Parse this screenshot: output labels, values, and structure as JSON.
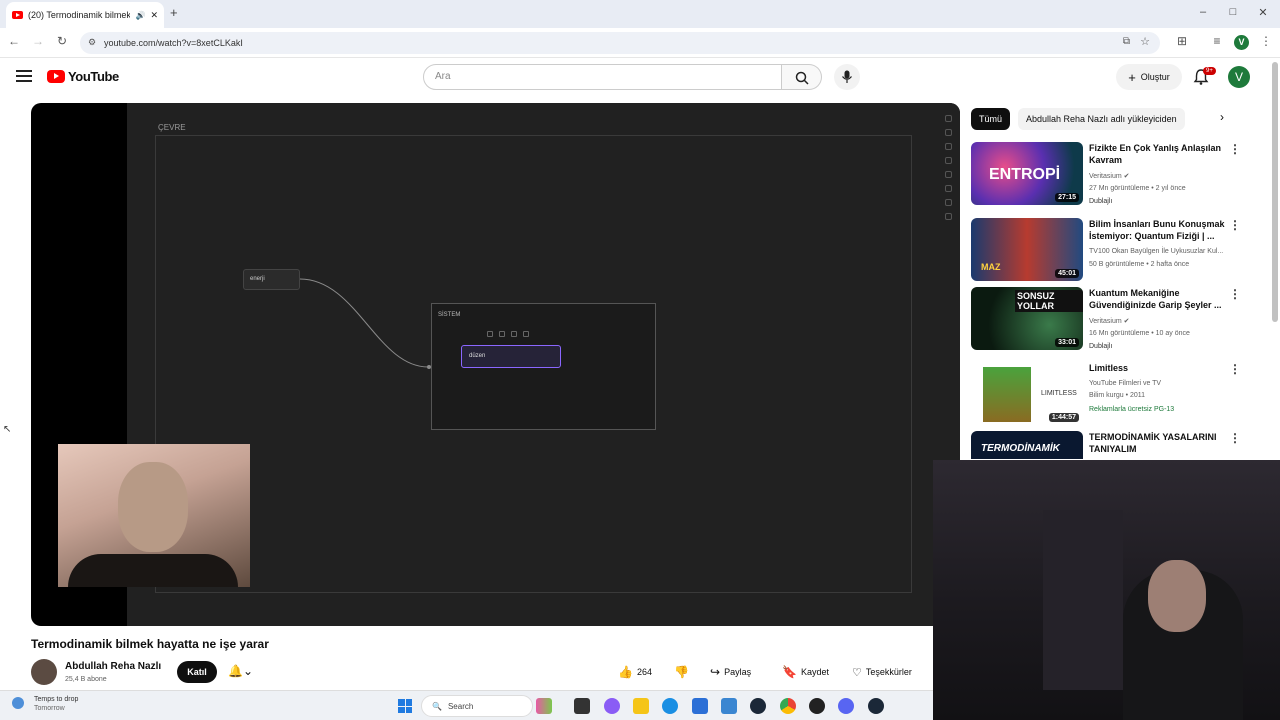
{
  "browser": {
    "tab_title": "(20) Termodinamik bilmek i",
    "new_tab": "+",
    "url": "youtube.com/watch?v=8xetCLKakI"
  },
  "header": {
    "logo": "YouTube",
    "search_placeholder": "Ara",
    "create_label": "Oluştur",
    "notification_badge": "9+",
    "user_initial": "V"
  },
  "player": {
    "frame_label": "ÇEVRE",
    "node_enerji": "enerji",
    "system_label": "SİSTEM",
    "node_duzen": "düzen"
  },
  "video": {
    "title": "Termodinamik bilmek hayatta ne işe yarar",
    "channel": "Abdullah Reha Nazlı",
    "subscribers": "25,4 B abone",
    "join": "Katıl",
    "likes": "264",
    "share": "Paylaş",
    "save": "Kaydet",
    "thanks": "Teşekkürler"
  },
  "chips": [
    "Tümü",
    "Abdullah Reha Nazlı adlı yükleyiciden"
  ],
  "recommendations": [
    {
      "title": "Fizikte En Çok Yanlış Anlaşılan Kavram",
      "channel": "Veritasium",
      "meta": "27 Mn görüntüleme • 2 yıl önce",
      "tag": "Dublajlı",
      "duration": "27:15",
      "thumb_text": "ENTROPİ"
    },
    {
      "title": "Bilim İnsanları Bunu Konuşmak İstemiyor: Quantum Fiziği | ...",
      "channel": "TV100 Okan Bayülgen İle Uykusuzlar Kul...",
      "meta": "50 B görüntüleme • 2 hafta önce",
      "tag": "",
      "duration": "45:01",
      "thumb_text": "MAZ"
    },
    {
      "title": "Kuantum Mekaniğine Güvendiğinizde Garip Şeyler ...",
      "channel": "Veritasium",
      "meta": "16 Mn görüntüleme • 10 ay önce",
      "tag": "Dublajlı",
      "duration": "33:01",
      "thumb_text": "SONSUZ YOLLAR"
    },
    {
      "title": "Limitless",
      "channel": "YouTube Filmleri ve TV",
      "meta": "Bilim kurgu • 2011",
      "tag": "Reklamlarla ücretsiz  PG-13",
      "duration": "1:44:57",
      "thumb_text": "LIMITLESS"
    },
    {
      "title": "TERMODİNAMİK YASALARINI TANIYALIM",
      "channel": "",
      "meta": "",
      "tag": "",
      "duration": "",
      "thumb_text": "TERMODİNAMİK"
    }
  ],
  "taskbar": {
    "weather_title": "Temps to drop",
    "weather_sub": "Tomorrow",
    "search": "Search"
  }
}
